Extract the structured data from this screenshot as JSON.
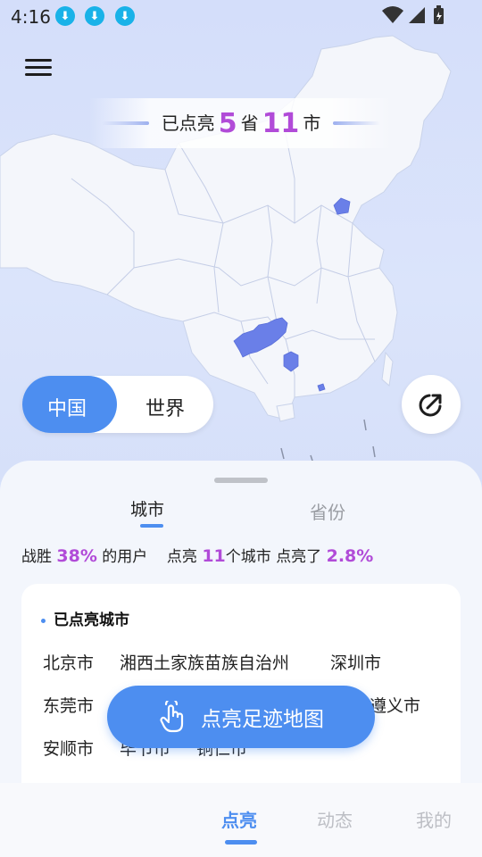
{
  "status_bar": {
    "time": "4:16",
    "download_icons": [
      "download-icon",
      "download-icon",
      "download-icon"
    ],
    "right_icons": [
      "wifi-icon",
      "signal-icon",
      "battery-icon"
    ]
  },
  "menu": {
    "icon": "hamburger-menu-icon"
  },
  "banner": {
    "prefix": "已点亮",
    "province_count": "5",
    "province_unit": "省",
    "city_count": "11",
    "city_unit": "市"
  },
  "region_toggle": {
    "options": [
      "中国",
      "世界"
    ],
    "selected": "中国"
  },
  "share": {
    "icon": "share-arrow-icon"
  },
  "sheet": {
    "tabs": [
      "城市",
      "省份"
    ],
    "active_tab": "城市",
    "stats": {
      "beat_prefix": "战胜",
      "beat_percent": "38%",
      "beat_suffix": "的用户",
      "lit_prefix": "点亮",
      "lit_count": "11",
      "lit_suffix": "个城市",
      "lit_percent_prefix": "点亮了",
      "lit_percent": "2.8%"
    },
    "card": {
      "title": "已点亮城市",
      "cities": [
        "北京市",
        "湘西土家族苗族自治州",
        "深圳市",
        "东莞市",
        "遵义市",
        "安顺市",
        "毕节市",
        "铜仁市"
      ]
    }
  },
  "cta": {
    "label": "点亮足迹地图",
    "icon": "tap-hand-icon"
  },
  "bottom_nav": {
    "items": [
      "点亮",
      "动态",
      "我的"
    ],
    "active": "点亮"
  },
  "colors": {
    "accent": "#4d8ef0",
    "highlight": "#b14bd8",
    "lit_region": "#6a7fe8",
    "map_land": "#f4f6fb",
    "map_bg": "#d7e2fb"
  }
}
